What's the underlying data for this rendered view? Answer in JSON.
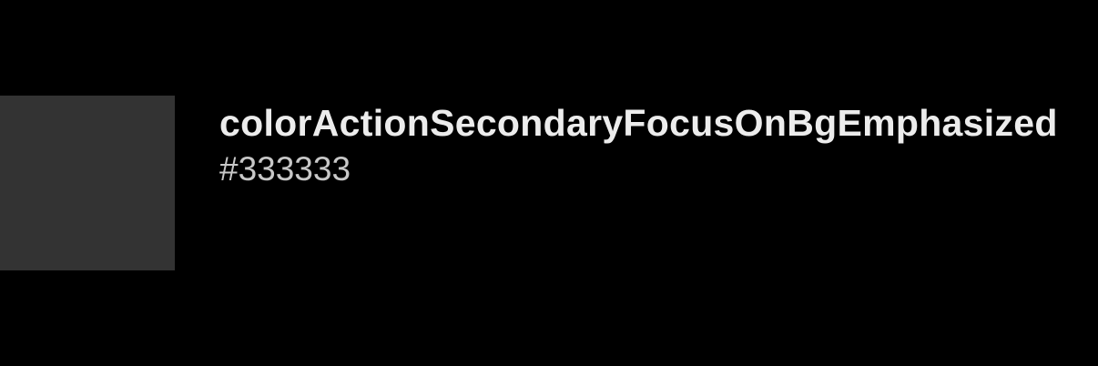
{
  "token": {
    "name": "colorActionSecondaryFocusOnBgEmphasized",
    "hex": "#333333",
    "swatch_color": "#333333"
  },
  "theme": {
    "background": "#000000",
    "name_color": "#ececec",
    "hex_color": "#c8c8c8"
  }
}
